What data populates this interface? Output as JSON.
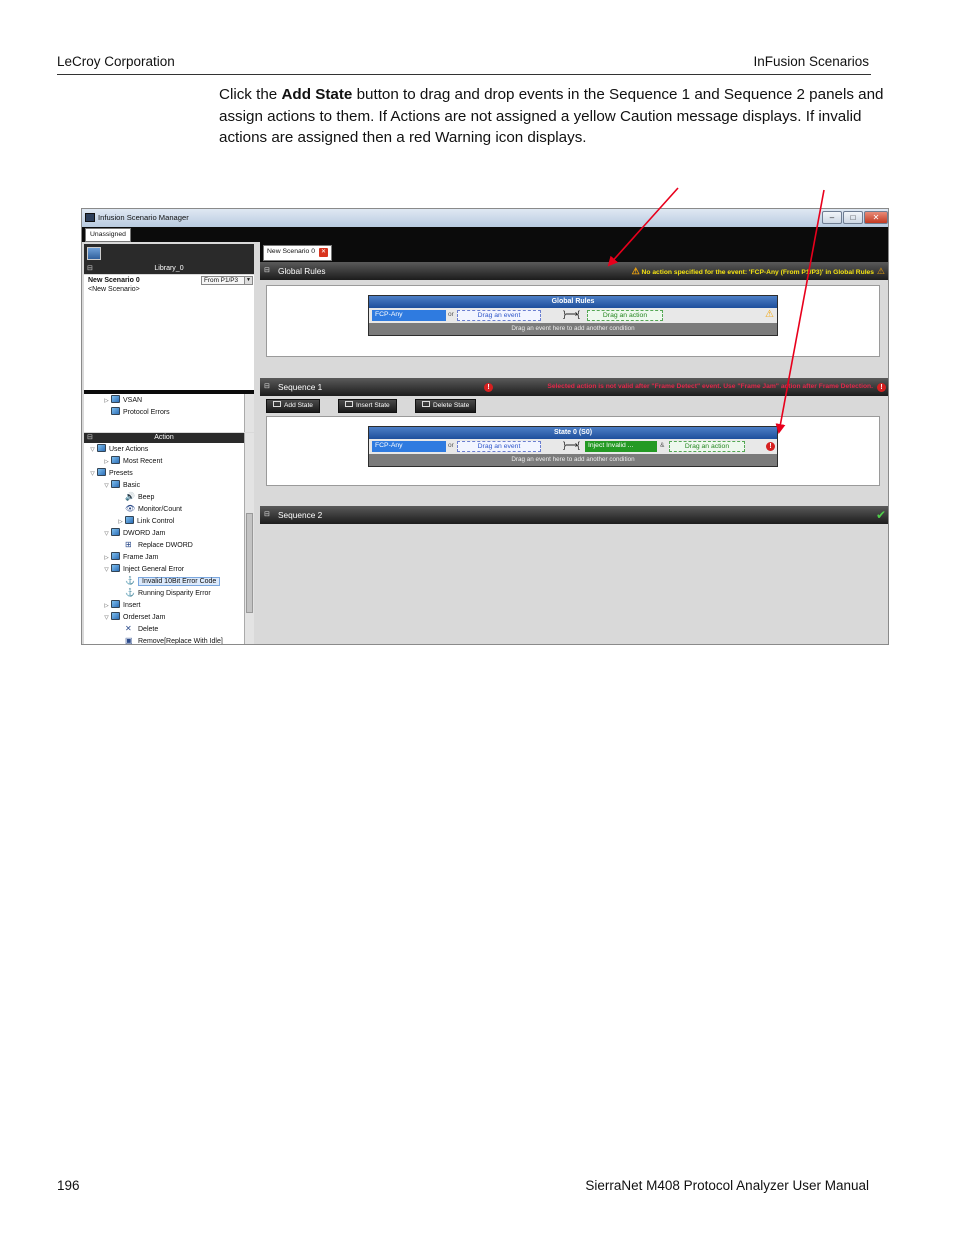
{
  "header": {
    "left": "LeCroy Corporation",
    "right": "InFusion Scenarios"
  },
  "intro": {
    "pre": "Click the ",
    "bold": "Add State",
    "post": " button to drag and drop events in the Sequence 1 and Sequence 2 panels and assign actions to them. If Actions are not assigned a yellow Caution message displays. If invalid actions are assigned then a red Warning icon displays."
  },
  "footer": {
    "page_number": "196",
    "manual_title": "SierraNet M408 Protocol Analyzer User Manual"
  },
  "window": {
    "title": "Infusion Scenario Manager",
    "buttons": {
      "minimize": "–",
      "maximize": "□",
      "close": "✕"
    },
    "top_tab": "Unassigned",
    "library": {
      "header": "Library_0",
      "scenario_name": "New Scenario 0",
      "scenario_desc": "<New Scenario>",
      "port_select": "From P1/P3",
      "tree": [
        {
          "label": "VSAN",
          "expand": "▷",
          "icon": "folder-icon"
        },
        {
          "label": "Protocol Errors",
          "expand": "",
          "icon": "protocol-errors-icon"
        }
      ]
    },
    "action": {
      "header": "Action",
      "tree": [
        {
          "label": "User Actions",
          "expand": "▽",
          "icon": "folder-icon"
        },
        {
          "label": "Most Recent",
          "expand": "▷",
          "icon": "folder-icon"
        },
        {
          "label": "Presets",
          "expand": "▽",
          "icon": "folder-icon"
        },
        {
          "label": "Basic",
          "expand": "▽",
          "icon": "folder-icon"
        },
        {
          "label": "Beep",
          "expand": "",
          "icon": "speaker-icon",
          "glyph": "🔊"
        },
        {
          "label": "Monitor/Count",
          "expand": "",
          "icon": "eye-icon",
          "glyph": "👁"
        },
        {
          "label": "Link Control",
          "expand": "▷",
          "icon": "folder-icon"
        },
        {
          "label": "DWORD Jam",
          "expand": "▽",
          "icon": "folder-icon"
        },
        {
          "label": "Replace DWORD",
          "expand": "",
          "icon": "replace-icon",
          "glyph": "⊞"
        },
        {
          "label": "Frame Jam",
          "expand": "▷",
          "icon": "folder-icon"
        },
        {
          "label": "Inject General Error",
          "expand": "▽",
          "icon": "folder-icon"
        },
        {
          "label": "Invalid 10Bit Error Code",
          "expand": "",
          "icon": "inject-icon",
          "glyph": "⚓"
        },
        {
          "label": "Running Disparity Error",
          "expand": "",
          "icon": "inject-icon",
          "glyph": "⚓"
        },
        {
          "label": "Insert",
          "expand": "▷",
          "icon": "folder-icon"
        },
        {
          "label": "Orderset Jam",
          "expand": "▽",
          "icon": "folder-icon"
        },
        {
          "label": "Delete",
          "expand": "",
          "icon": "delete-icon",
          "glyph": "✕"
        },
        {
          "label": "Remove[Replace With Idle]",
          "expand": "",
          "icon": "remove-icon",
          "glyph": "▣"
        }
      ]
    },
    "doc_tab": "New Scenario 0",
    "global_rules": {
      "section_label": "Global Rules",
      "warning": "No action specified for the event: 'FCP-Any (From P1/P3)' in Global Rules",
      "block_title": "Global Rules",
      "event": "FCP-Any",
      "or": "or",
      "drag_event": "Drag an event",
      "drag_action": "Drag an action",
      "footer": "Drag an event here to add another condition"
    },
    "sequence1": {
      "section_label": "Sequence 1",
      "error": "Selected action is not valid after \"Frame Detect\" event. Use \"Frame Jam\" action after Frame Detection.",
      "buttons": {
        "add": "Add State",
        "insert": "Insert State",
        "delete": "Delete State"
      },
      "block_title": "State 0 (S0)",
      "event": "FCP-Any",
      "or": "or",
      "drag_event": "Drag an event",
      "action": "Inject Invalid ...",
      "amp": "&",
      "drag_action": "Drag an action",
      "footer": "Drag an event here to add another condition"
    },
    "sequence2": {
      "section_label": "Sequence 2"
    }
  },
  "colors": {
    "caution": "#f3e212",
    "error": "#e0284a",
    "arrow": "#e8001c",
    "ok": "#4fcf4a"
  }
}
